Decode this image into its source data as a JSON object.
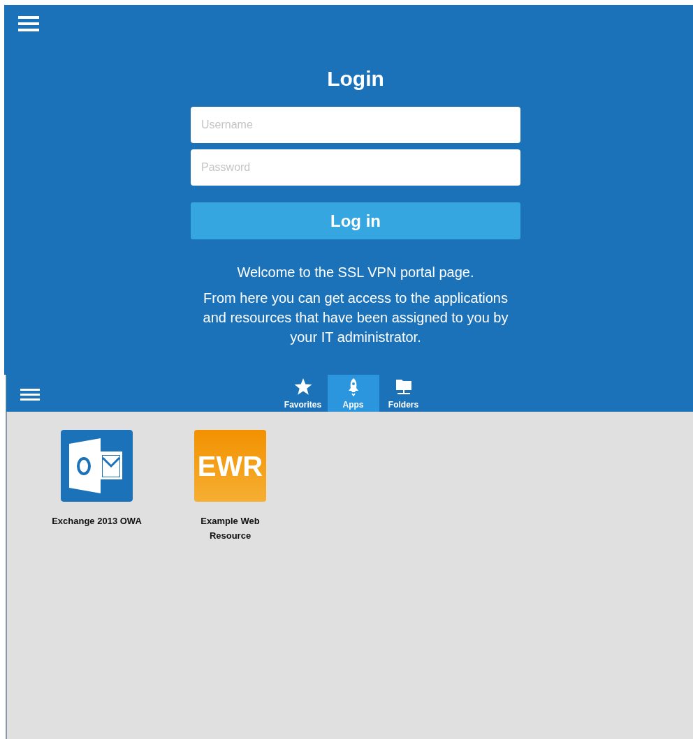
{
  "login": {
    "title": "Login",
    "username": {
      "placeholder": "Username"
    },
    "password": {
      "placeholder": "Password"
    },
    "button": "Log in",
    "welcome": "Welcome to the SSL VPN portal page.",
    "info": "From here you can get access to the applications and resources that have been assigned to you by your IT administrator."
  },
  "tabs": [
    {
      "label": "Favorites",
      "kind": "star",
      "selected": false
    },
    {
      "label": "Apps",
      "kind": "rocket",
      "selected": true
    },
    {
      "label": "Folders",
      "kind": "folder",
      "selected": false
    }
  ],
  "apps": [
    {
      "label": "Exchange 2013 OWA",
      "kind": "mail"
    },
    {
      "label": "Example Web Resource",
      "kind": "text",
      "text": "EWR"
    }
  ]
}
